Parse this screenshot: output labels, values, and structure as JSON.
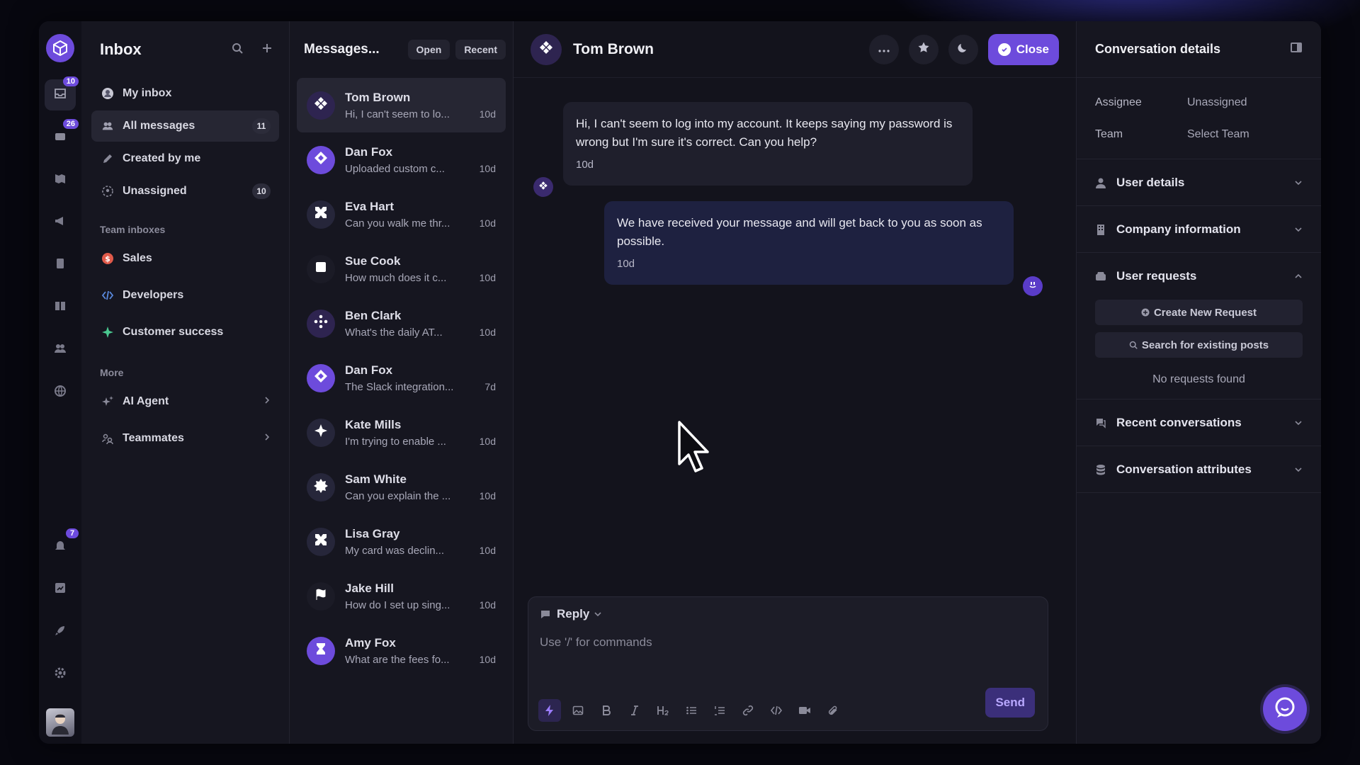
{
  "colors": {
    "accent": "#6d4bdc",
    "background": "#07070f",
    "panel": "#161620",
    "chat_bg": "#13131c"
  },
  "rail": {
    "logo_icon": "cube-logo-icon",
    "items": [
      {
        "name": "inbox",
        "icon": "inbox-icon",
        "badge": "10",
        "active": true
      },
      {
        "name": "tickets",
        "icon": "tray-icon",
        "badge": "26"
      },
      {
        "name": "knowledge",
        "icon": "map-icon"
      },
      {
        "name": "outbound",
        "icon": "megaphone-icon"
      },
      {
        "name": "reports",
        "icon": "clipboard-icon"
      },
      {
        "name": "articles",
        "icon": "book-icon"
      },
      {
        "name": "contacts",
        "icon": "people-icon"
      },
      {
        "name": "global",
        "icon": "globe-icon"
      }
    ],
    "bottom": [
      {
        "name": "notifications",
        "icon": "bell-icon",
        "badge": "7"
      },
      {
        "name": "analytics",
        "icon": "chart-icon"
      },
      {
        "name": "launch",
        "icon": "rocket-icon"
      },
      {
        "name": "settings",
        "icon": "gear-icon"
      }
    ]
  },
  "nav": {
    "title": "Inbox",
    "items": [
      {
        "label": "My inbox",
        "icon": "user-circle-icon"
      },
      {
        "label": "All messages",
        "icon": "people-icon",
        "count": "11",
        "active": true
      },
      {
        "label": "Created by me",
        "icon": "pen-icon"
      },
      {
        "label": "Unassigned",
        "icon": "unassigned-icon",
        "count": "10"
      }
    ],
    "team_label": "Team inboxes",
    "teams": [
      {
        "label": "Sales",
        "icon": "dollar-icon",
        "color": "#e05a4a"
      },
      {
        "label": "Developers",
        "icon": "code-icon",
        "color": "#5a8ae0"
      },
      {
        "label": "Customer success",
        "icon": "sparkle-icon",
        "color": "#4ac890"
      }
    ],
    "more_label": "More",
    "more": [
      {
        "label": "AI Agent",
        "icon": "ai-sparkle-icon"
      },
      {
        "label": "Teammates",
        "icon": "teammates-icon"
      }
    ]
  },
  "list": {
    "title": "Messages...",
    "filter_open": "Open",
    "filter_sort": "Recent",
    "conversations": [
      {
        "name": "Tom Brown",
        "preview": "Hi, I can't seem to lo...",
        "time": "10d",
        "active": true,
        "avatar_bg": "#2e2450",
        "icon": "diamond-dots-icon"
      },
      {
        "name": "Dan Fox",
        "preview": "Uploaded custom c...",
        "time": "10d",
        "avatar_bg": "#6d4bdc",
        "icon": "diamond-icon"
      },
      {
        "name": "Eva Hart",
        "preview": "Can you walk me thr...",
        "time": "10d",
        "avatar_bg": "#26263a",
        "icon": "x-shape-icon"
      },
      {
        "name": "Sue Cook",
        "preview": "How much does it c...",
        "time": "10d",
        "avatar_bg": "#1b1b26",
        "icon": "square-icon"
      },
      {
        "name": "Ben Clark",
        "preview": "What's the daily AT...",
        "time": "10d",
        "avatar_bg": "#2e2450",
        "icon": "dots-cross-icon"
      },
      {
        "name": "Dan Fox",
        "preview": "The Slack integration...",
        "time": "7d",
        "avatar_bg": "#6d4bdc",
        "icon": "diamond-icon"
      },
      {
        "name": "Kate Mills",
        "preview": "I'm trying to enable ...",
        "time": "10d",
        "avatar_bg": "#26263a",
        "icon": "star4-icon"
      },
      {
        "name": "Sam White",
        "preview": "Can you explain the ...",
        "time": "10d",
        "avatar_bg": "#26263a",
        "icon": "badge-star-icon"
      },
      {
        "name": "Lisa Gray",
        "preview": "My card was declin...",
        "time": "10d",
        "avatar_bg": "#26263a",
        "icon": "x-shape-icon"
      },
      {
        "name": "Jake Hill",
        "preview": "How do I set up sing...",
        "time": "10d",
        "avatar_bg": "#1b1b26",
        "icon": "flag-icon"
      },
      {
        "name": "Amy Fox",
        "preview": "What are the fees fo...",
        "time": "10d",
        "avatar_bg": "#6d4bdc",
        "icon": "hourglass-icon"
      }
    ]
  },
  "chat": {
    "contact_name": "Tom Brown",
    "more_icon": "ellipsis-icon",
    "star_icon": "star-icon",
    "snooze_icon": "moon-icon",
    "close_label": "Close",
    "messages": [
      {
        "direction": "in",
        "text": "Hi, I can't seem to log into my account. It keeps saying my password is wrong but I'm sure it's correct. Can you help?",
        "time": "10d"
      },
      {
        "direction": "out",
        "text": "We have received your message and will get back to you as soon as possible.",
        "time": "10d"
      }
    ],
    "composer": {
      "mode": "Reply",
      "placeholder": "Use '/' for commands",
      "send_label": "Send",
      "tools": [
        "lightning-icon",
        "image-icon",
        "bold-icon",
        "italic-icon",
        "heading2-icon",
        "bullet-list-icon",
        "numbered-list-icon",
        "link-icon",
        "code-icon",
        "video-icon",
        "paperclip-icon"
      ]
    }
  },
  "details": {
    "title": "Conversation details",
    "assignee_label": "Assignee",
    "assignee_value": "Unassigned",
    "team_label": "Team",
    "team_value": "Select Team",
    "sections": {
      "user_details": "User details",
      "company": "Company information",
      "user_requests": "User requests",
      "recent": "Recent conversations",
      "attributes": "Conversation attributes"
    },
    "create_request": "Create New Request",
    "search_posts": "Search for existing posts",
    "no_requests": "No requests found"
  }
}
